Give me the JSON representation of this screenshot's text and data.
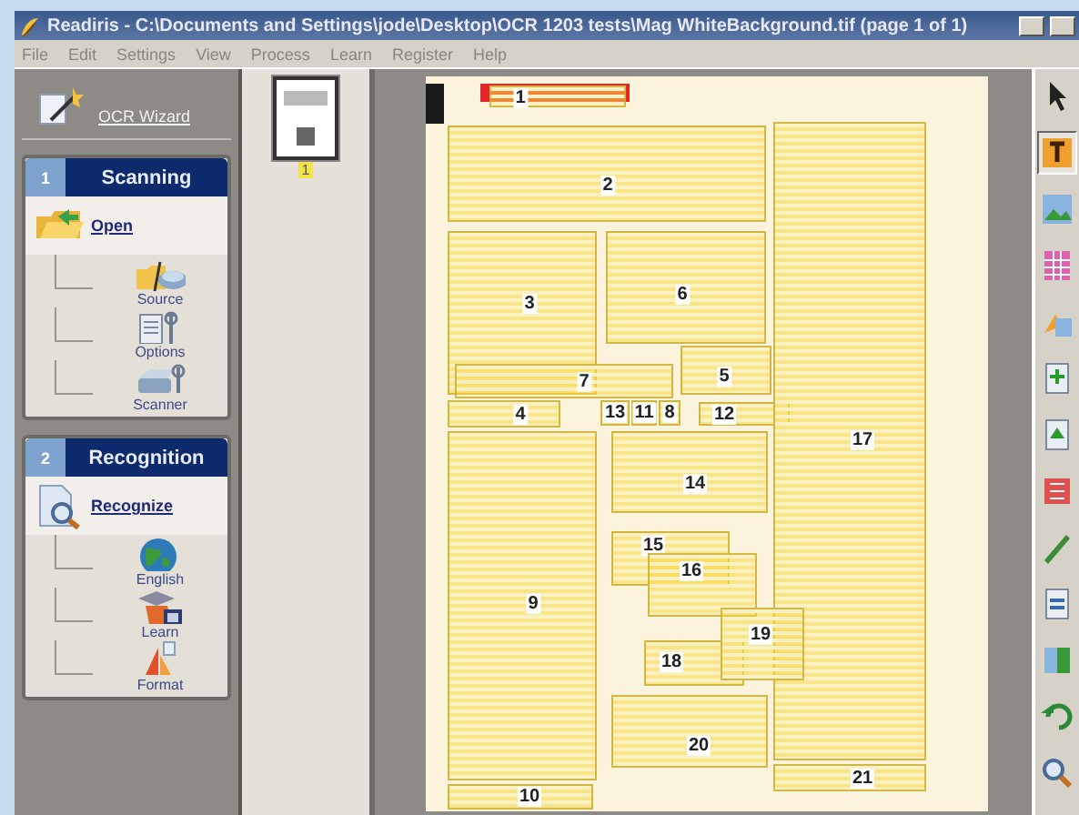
{
  "window": {
    "title": "Readiris - C:\\Documents and Settings\\jode\\Desktop\\OCR 1203 tests\\Mag WhiteBackground.tif (page 1 of 1)"
  },
  "menu": [
    "File",
    "Edit",
    "Settings",
    "View",
    "Process",
    "Learn",
    "Register",
    "Help"
  ],
  "wizard": {
    "label": "OCR Wizard"
  },
  "sections": [
    {
      "number": "1",
      "title": "Scanning",
      "action": {
        "kind": "open",
        "label": "Open"
      },
      "items": [
        {
          "kind": "source",
          "label": "Source"
        },
        {
          "kind": "options",
          "label": "Options"
        },
        {
          "kind": "scanner",
          "label": "Scanner"
        }
      ]
    },
    {
      "number": "2",
      "title": "Recognition",
      "action": {
        "kind": "recognize",
        "label": "Recognize"
      },
      "items": [
        {
          "kind": "language",
          "label": "English"
        },
        {
          "kind": "learn",
          "label": "Learn"
        },
        {
          "kind": "format",
          "label": "Format"
        }
      ]
    }
  ],
  "thumbnails": [
    {
      "page": "1",
      "selected": true
    }
  ],
  "zones": [
    {
      "number": "1"
    },
    {
      "number": "2"
    },
    {
      "number": "3"
    },
    {
      "number": "4"
    },
    {
      "number": "5"
    },
    {
      "number": "6"
    },
    {
      "number": "7"
    },
    {
      "number": "13"
    },
    {
      "number": "11"
    },
    {
      "number": "8"
    },
    {
      "number": "12"
    },
    {
      "number": "9"
    },
    {
      "number": "10"
    },
    {
      "number": "14"
    },
    {
      "number": "15"
    },
    {
      "number": "16"
    },
    {
      "number": "17"
    },
    {
      "number": "18"
    },
    {
      "number": "19"
    },
    {
      "number": "20"
    },
    {
      "number": "21"
    }
  ],
  "tools": [
    {
      "kind": "pointer",
      "selected": false
    },
    {
      "kind": "text",
      "selected": true
    },
    {
      "kind": "image",
      "selected": false
    },
    {
      "kind": "table",
      "selected": false
    },
    {
      "kind": "zone-auto",
      "selected": false
    },
    {
      "kind": "zone-add",
      "selected": false
    },
    {
      "kind": "zone-order",
      "selected": false
    },
    {
      "kind": "zone-book",
      "selected": false
    },
    {
      "kind": "zone-draw",
      "selected": false
    },
    {
      "kind": "zone-edit",
      "selected": false
    },
    {
      "kind": "zone-merge",
      "selected": false
    },
    {
      "kind": "undo",
      "selected": false
    },
    {
      "kind": "zoom",
      "selected": false
    }
  ]
}
